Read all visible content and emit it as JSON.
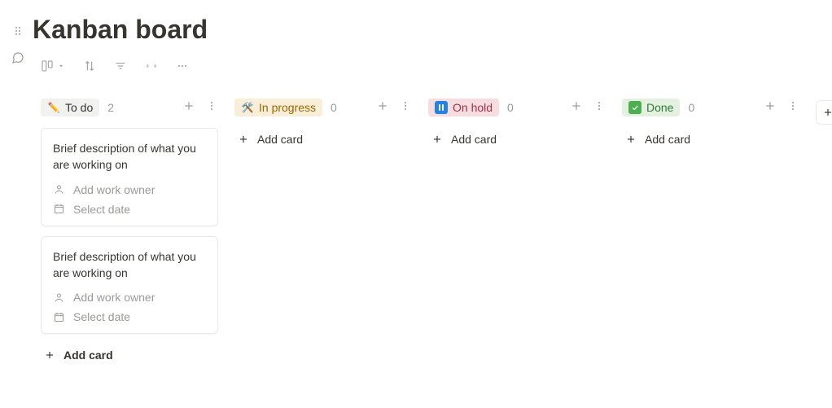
{
  "page": {
    "title": "Kanban board"
  },
  "toolbar": {
    "view": "board"
  },
  "columns": [
    {
      "id": "todo",
      "label": "To do",
      "count": "2",
      "pillClass": "pill-todo",
      "icon": "pencil",
      "cards": [
        {
          "title": "Brief description of what you are working on",
          "owner_placeholder": "Add work owner",
          "date_placeholder": "Select date"
        },
        {
          "title": "Brief description of what you are working on",
          "owner_placeholder": "Add work owner",
          "date_placeholder": "Select date"
        }
      ],
      "add_label": "Add card"
    },
    {
      "id": "inprogress",
      "label": "In progress",
      "count": "0",
      "pillClass": "pill-progress",
      "icon": "tools",
      "cards": [],
      "add_label": "Add card"
    },
    {
      "id": "onhold",
      "label": "On hold",
      "count": "0",
      "pillClass": "pill-hold",
      "icon": "pause",
      "cards": [],
      "add_label": "Add card"
    },
    {
      "id": "done",
      "label": "Done",
      "count": "0",
      "pillClass": "pill-done",
      "icon": "check",
      "cards": [],
      "add_label": "Add card"
    }
  ]
}
